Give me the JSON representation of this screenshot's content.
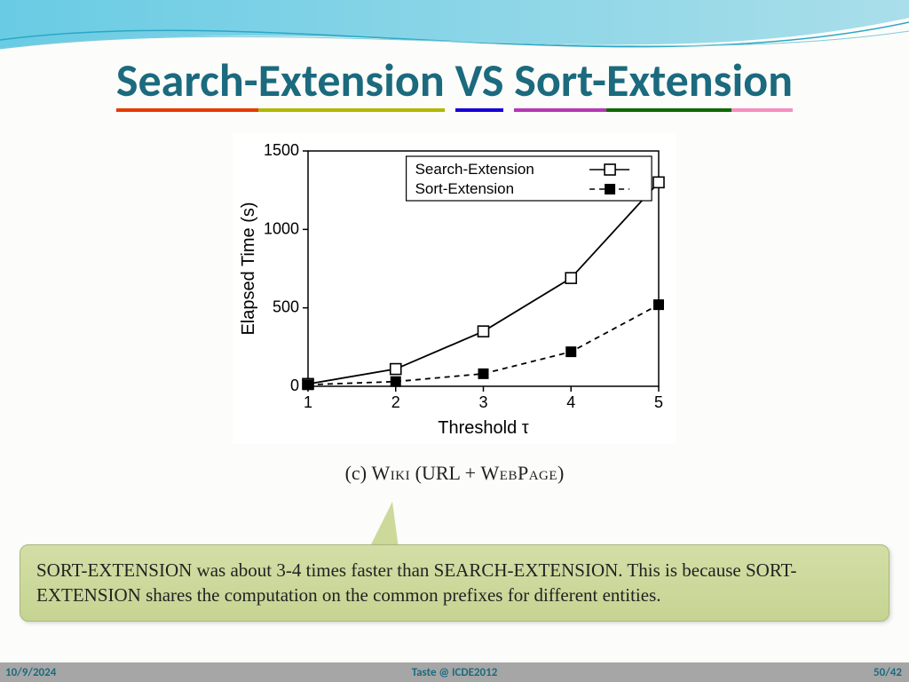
{
  "title": {
    "word1": "Search-Extension",
    "word2": "VS",
    "word3": "Sort-Extension"
  },
  "chart_data": {
    "type": "line",
    "xlabel": "Threshold τ",
    "ylabel": "Elapsed Time (s)",
    "categories": [
      1,
      2,
      3,
      4,
      5
    ],
    "x_ticks": [
      "1",
      "2",
      "3",
      "4",
      "5"
    ],
    "y_ticks": [
      "0",
      "500",
      "1000",
      "1500"
    ],
    "ylim": [
      0,
      1500
    ],
    "xlim": [
      1,
      5
    ],
    "series": [
      {
        "name": "Search-Extension",
        "marker": "open-square",
        "line": "solid",
        "values": [
          15,
          110,
          350,
          690,
          1300
        ]
      },
      {
        "name": "Sort-Extension",
        "marker": "filled-square",
        "line": "dashed",
        "values": [
          10,
          30,
          80,
          220,
          520
        ]
      }
    ],
    "legend_position": "top-center"
  },
  "caption": {
    "prefix": "(c) ",
    "smallcaps1": "Wiki",
    "middle": " (URL + ",
    "smallcaps2": "WebPage",
    "suffix": ")"
  },
  "callout": {
    "text": "SORT-EXTENSION was about 3-4 times faster than SEARCH-EXTENSION. This is because SORT-EXTENSION shares the computation on the common prefixes for different entities."
  },
  "footer": {
    "date": "10/9/2024",
    "venue": "Taste @ ICDE2012",
    "page": "50/42"
  }
}
